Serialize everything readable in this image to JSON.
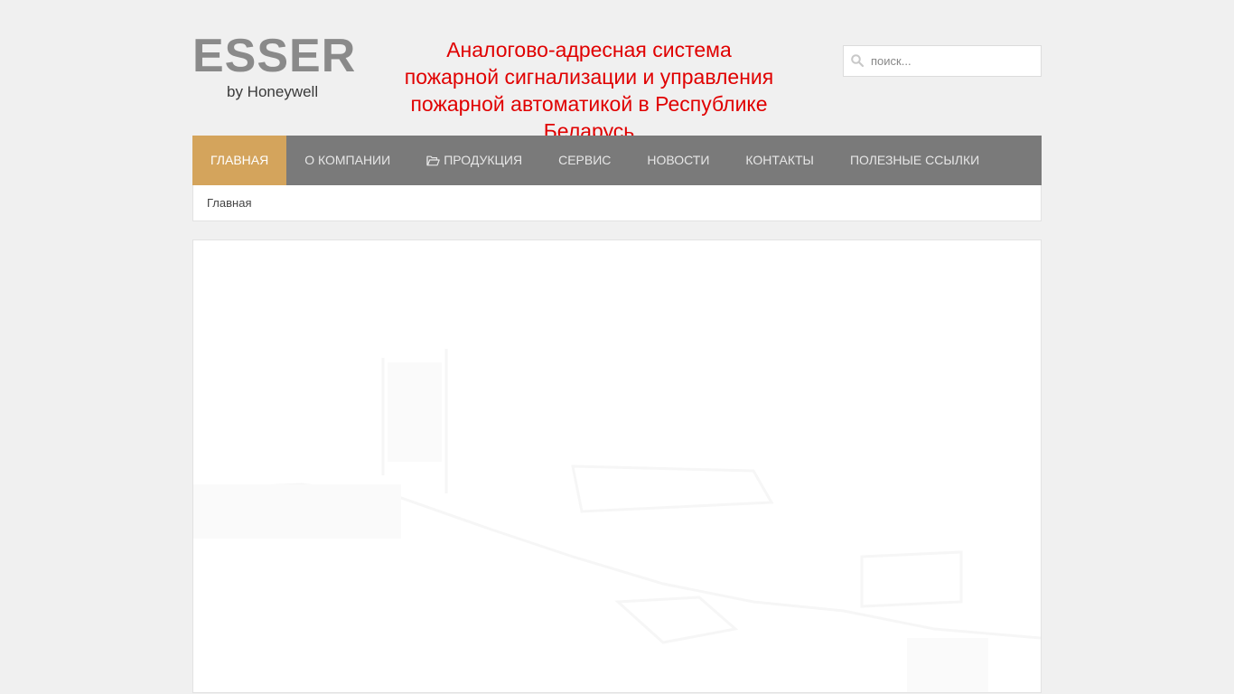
{
  "logo": {
    "word": "ESSER",
    "sub": "by Honeywell"
  },
  "site": {
    "title": "Аналогово-адресная система пожарной сигнализации и управления пожарной автоматикой в Республике Беларусь"
  },
  "search": {
    "placeholder": "поиск..."
  },
  "nav": {
    "items": [
      {
        "label": "Главная",
        "active": true
      },
      {
        "label": "О компании"
      },
      {
        "label": "Продукция",
        "icon": "folder-open-icon"
      },
      {
        "label": "Сервис"
      },
      {
        "label": "Новости"
      },
      {
        "label": "Контакты"
      },
      {
        "label": "Полезные ссылки"
      }
    ]
  },
  "breadcrumb": {
    "current": "Главная"
  },
  "colors": {
    "title": "#e00000",
    "nav_bg": "#7a7a7a",
    "nav_active": "#d4a45c",
    "page_bg": "#f0f0f0"
  }
}
